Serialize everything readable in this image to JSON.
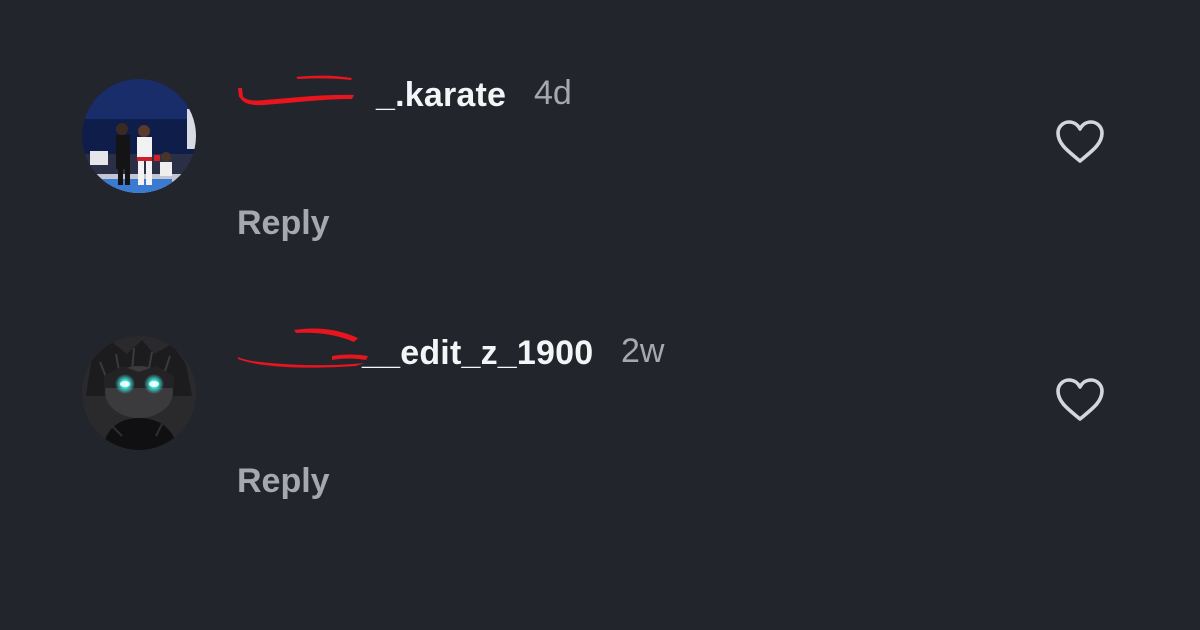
{
  "comments": [
    {
      "username": "_.karate",
      "time": "4d",
      "reply_label": "Reply",
      "avatar_icon": "karate-avatar",
      "like_icon": "heart-outline-icon"
    },
    {
      "username": "__edit_z_1900",
      "time": "2w",
      "reply_label": "Reply",
      "avatar_icon": "anime-avatar",
      "like_icon": "heart-outline-icon"
    }
  ],
  "colors": {
    "background": "#23252d",
    "username": "#f4f5f7",
    "secondary_text": "#a6a8b0",
    "redaction": "#e8141e"
  }
}
